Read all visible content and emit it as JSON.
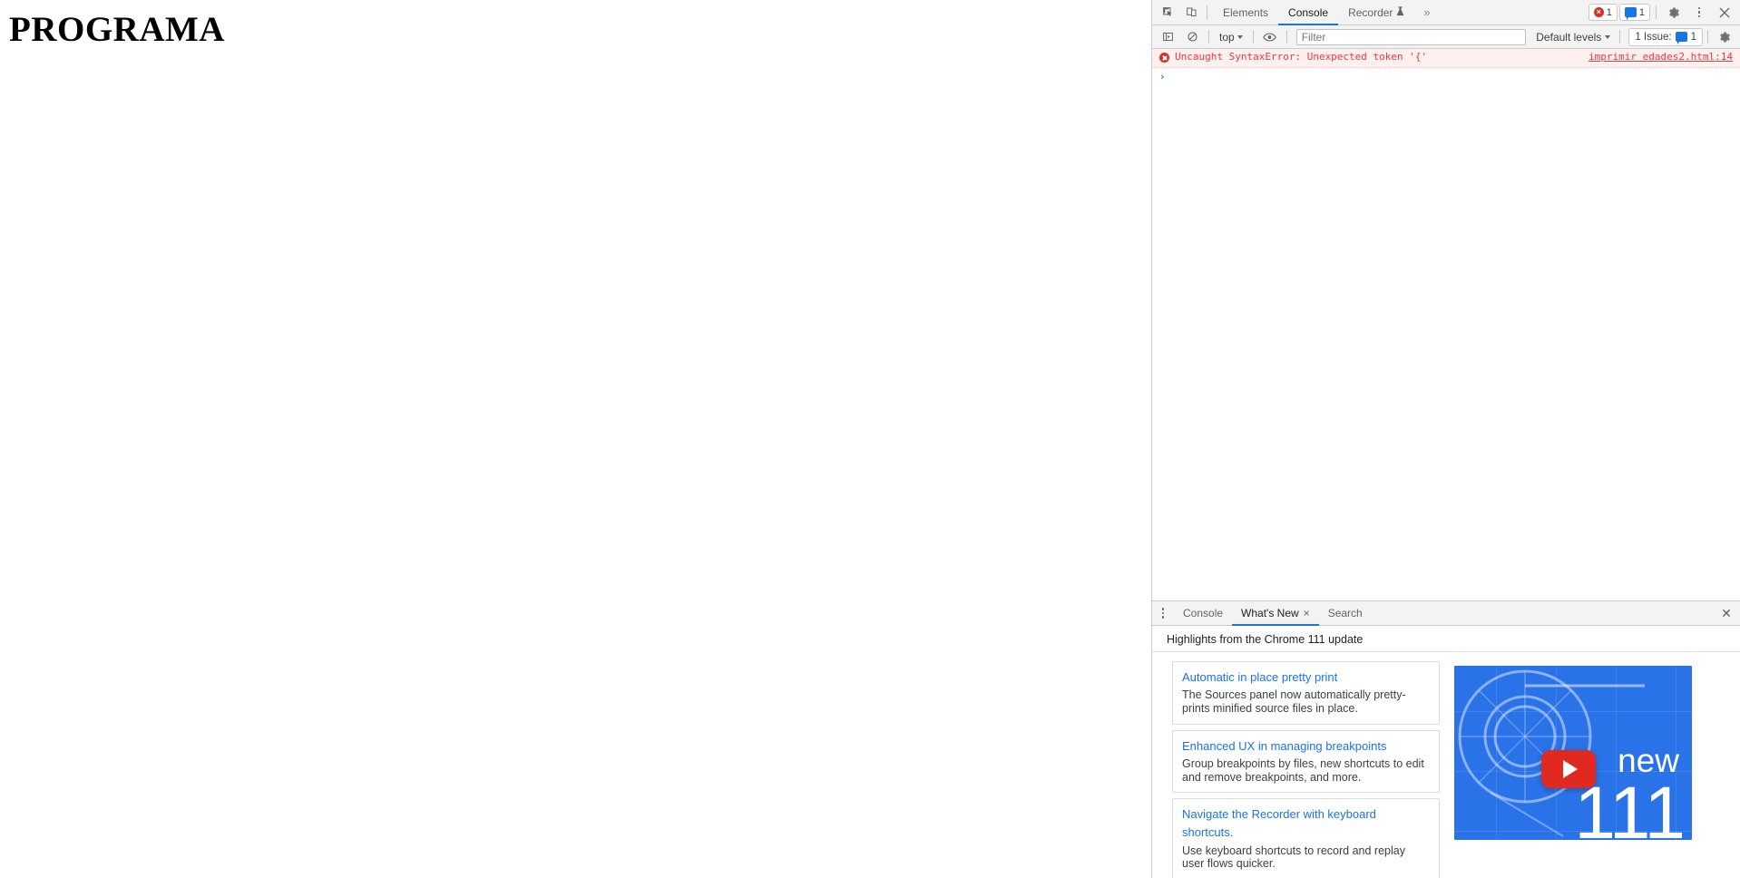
{
  "webpage": {
    "heading": "PROGRAMA"
  },
  "devtools": {
    "main_tabs": [
      {
        "label": "Elements",
        "active": false
      },
      {
        "label": "Console",
        "active": true
      },
      {
        "label": "Recorder",
        "active": false,
        "badge": "flask-icon"
      }
    ],
    "overflow_label": "»",
    "toolbar_icons": {
      "inspect": "inspect-element-icon",
      "device": "device-toolbar-icon",
      "settings": "gear-icon",
      "more": "kebab-menu-icon",
      "close": "close-icon"
    },
    "counters": {
      "errors": "1",
      "messages": "1"
    },
    "console_toolbar": {
      "sidebar_toggle": "console-sidebar-icon",
      "clear": "clear-console-icon",
      "context": "top",
      "eye": "live-expression-icon",
      "filter_placeholder": "Filter",
      "filter_value": "",
      "levels": "Default levels",
      "issues_label": "1 Issue:",
      "issues_count": "1",
      "settings": "gear-icon"
    },
    "console_messages": [
      {
        "type": "error",
        "text": "Uncaught SyntaxError: Unexpected token '{'",
        "source": "imprimir edades2.html:14"
      }
    ],
    "prompt": {
      "caret": "›",
      "value": ""
    },
    "drawer": {
      "tabs": [
        {
          "label": "Console",
          "active": false,
          "closeable": false
        },
        {
          "label": "What's New",
          "active": true,
          "closeable": true,
          "close_glyph": "×"
        },
        {
          "label": "Search",
          "active": false,
          "closeable": false
        }
      ],
      "close_glyph": "✕",
      "subtitle": "Highlights from the Chrome 111 update",
      "cards": [
        {
          "title": "Automatic in place pretty print",
          "desc": "The Sources panel now automatically pretty-prints minified source files in place."
        },
        {
          "title": "Enhanced UX in managing breakpoints",
          "desc": "Group breakpoints by files, new shortcuts to edit and remove breakpoints, and more."
        },
        {
          "title": "Navigate the Recorder with keyboard shortcuts.",
          "desc": "Use keyboard shortcuts to record and replay user flows quicker."
        }
      ],
      "banner": {
        "new_label": "new",
        "version": "111",
        "play_icon": "youtube-play-icon",
        "bg_color": "#2a72e8",
        "play_color": "#e02a21"
      }
    }
  },
  "colors": {
    "accent": "#1a73e8",
    "error": "#d93025",
    "error_text": "#eb3941",
    "error_bg": "#fff0f0",
    "toolbar_bg": "#f3f3f3",
    "border": "#cdcdcd"
  }
}
